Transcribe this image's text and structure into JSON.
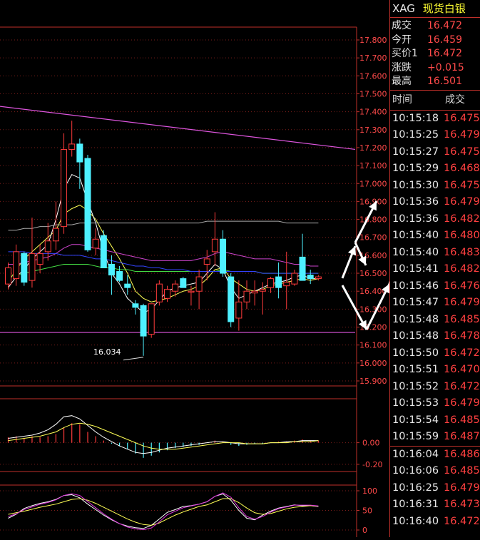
{
  "quote": {
    "symbol": "XAG",
    "name": "现货白银",
    "rows": [
      {
        "label": "成交",
        "value": "16.472"
      },
      {
        "label": "今开",
        "value": "16.459"
      },
      {
        "label": "买价1",
        "value": "16.472"
      },
      {
        "label": "涨跌",
        "value": "+0.015"
      },
      {
        "label": "最高",
        "value": "16.501"
      }
    ]
  },
  "ticks": {
    "header_time": "时间",
    "header_price": "成交",
    "rows": [
      {
        "time": "10:15:18",
        "price": "16.475"
      },
      {
        "time": "10:15:25",
        "price": "16.479"
      },
      {
        "time": "10:15:27",
        "price": "16.475"
      },
      {
        "time": "10:15:29",
        "price": "16.468"
      },
      {
        "time": "10:15:30",
        "price": "16.475"
      },
      {
        "time": "10:15:36",
        "price": "16.479"
      },
      {
        "time": "10:15:36",
        "price": "16.482"
      },
      {
        "time": "10:15:40",
        "price": "16.480"
      },
      {
        "time": "10:15:40",
        "price": "16.483"
      },
      {
        "time": "10:15:41",
        "price": "16.482"
      },
      {
        "time": "10:15:46",
        "price": "16.476"
      },
      {
        "time": "10:15:47",
        "price": "16.479"
      },
      {
        "time": "10:15:48",
        "price": "16.485"
      },
      {
        "time": "10:15:48",
        "price": "16.478"
      },
      {
        "time": "10:15:50",
        "price": "16.472"
      },
      {
        "time": "10:15:51",
        "price": "16.470"
      },
      {
        "time": "10:15:52",
        "price": "16.472"
      },
      {
        "time": "10:15:53",
        "price": "16.479"
      },
      {
        "time": "10:15:54",
        "price": "16.485"
      },
      {
        "time": "10:15:59",
        "price": "16.487"
      },
      {
        "time": "10:16:04",
        "price": "16.486"
      },
      {
        "time": "10:16:06",
        "price": "16.485"
      },
      {
        "time": "10:16:25",
        "price": "16.479"
      },
      {
        "time": "10:16:31",
        "price": "16.473"
      },
      {
        "time": "10:16:40",
        "price": "16.472"
      }
    ]
  },
  "chart_data": [
    {
      "type": "candlestick",
      "y_ticks": [
        "17.800",
        "17.700",
        "17.600",
        "17.500",
        "17.400",
        "17.300",
        "17.200",
        "17.100",
        "17.000",
        "16.900",
        "16.800",
        "16.700",
        "16.600",
        "16.500",
        "16.400",
        "16.300",
        "16.200",
        "16.100",
        "16.000",
        "15.900"
      ],
      "ylim": [
        15.9,
        17.8
      ],
      "low_annotation": "16.034",
      "colors": {
        "up": "#ff3b3b",
        "down": "#4ef0ff",
        "axis": "#c0302a"
      },
      "candles": [
        {
          "o": 16.44,
          "h": 16.56,
          "l": 16.41,
          "c": 16.53
        },
        {
          "o": 16.47,
          "h": 16.66,
          "l": 16.43,
          "c": 16.62
        },
        {
          "o": 16.61,
          "h": 16.62,
          "l": 16.43,
          "c": 16.45
        },
        {
          "o": 16.46,
          "h": 16.81,
          "l": 16.42,
          "c": 16.61
        },
        {
          "o": 16.55,
          "h": 16.66,
          "l": 16.5,
          "c": 16.61
        },
        {
          "o": 16.62,
          "h": 16.78,
          "l": 16.57,
          "c": 16.68
        },
        {
          "o": 16.68,
          "h": 16.9,
          "l": 16.63,
          "c": 16.75
        },
        {
          "o": 16.76,
          "h": 17.28,
          "l": 16.72,
          "c": 17.19
        },
        {
          "o": 17.19,
          "h": 17.35,
          "l": 17.15,
          "c": 17.22
        },
        {
          "o": 17.22,
          "h": 17.25,
          "l": 16.97,
          "c": 17.12
        },
        {
          "o": 17.14,
          "h": 17.16,
          "l": 16.62,
          "c": 16.63
        },
        {
          "o": 16.64,
          "h": 16.75,
          "l": 16.6,
          "c": 16.69
        },
        {
          "o": 16.71,
          "h": 16.74,
          "l": 16.54,
          "c": 16.53
        },
        {
          "o": 16.55,
          "h": 16.6,
          "l": 16.38,
          "c": 16.49
        },
        {
          "o": 16.51,
          "h": 16.54,
          "l": 16.45,
          "c": 16.46
        },
        {
          "o": 16.44,
          "h": 16.49,
          "l": 16.38,
          "c": 16.42
        },
        {
          "o": 16.33,
          "h": 16.35,
          "l": 16.27,
          "c": 16.31
        },
        {
          "o": 16.32,
          "h": 16.33,
          "l": 16.04,
          "c": 16.15
        },
        {
          "o": 16.16,
          "h": 16.3,
          "l": 16.14,
          "c": 16.33
        },
        {
          "o": 16.34,
          "h": 16.46,
          "l": 16.32,
          "c": 16.44
        },
        {
          "o": 16.36,
          "h": 16.43,
          "l": 16.34,
          "c": 16.41
        },
        {
          "o": 16.4,
          "h": 16.46,
          "l": 16.37,
          "c": 16.44
        },
        {
          "o": 16.47,
          "h": 16.48,
          "l": 16.42,
          "c": 16.42
        },
        {
          "o": 16.4,
          "h": 16.43,
          "l": 16.32,
          "c": 16.4
        },
        {
          "o": 16.4,
          "h": 16.52,
          "l": 16.3,
          "c": 16.48
        },
        {
          "o": 16.55,
          "h": 16.63,
          "l": 16.46,
          "c": 16.58
        },
        {
          "o": 16.62,
          "h": 16.84,
          "l": 16.54,
          "c": 16.69
        },
        {
          "o": 16.69,
          "h": 16.74,
          "l": 16.48,
          "c": 16.5
        },
        {
          "o": 16.48,
          "h": 16.5,
          "l": 16.2,
          "c": 16.23
        },
        {
          "o": 16.25,
          "h": 16.46,
          "l": 16.18,
          "c": 16.34
        },
        {
          "o": 16.34,
          "h": 16.46,
          "l": 16.3,
          "c": 16.4
        },
        {
          "o": 16.39,
          "h": 16.46,
          "l": 16.32,
          "c": 16.4
        },
        {
          "o": 16.4,
          "h": 16.45,
          "l": 16.27,
          "c": 16.41
        },
        {
          "o": 16.42,
          "h": 16.48,
          "l": 16.39,
          "c": 16.47
        },
        {
          "o": 16.48,
          "h": 16.56,
          "l": 16.36,
          "c": 16.42
        },
        {
          "o": 16.43,
          "h": 16.62,
          "l": 16.3,
          "c": 16.45
        },
        {
          "o": 16.44,
          "h": 16.52,
          "l": 16.43,
          "c": 16.5
        },
        {
          "o": 16.59,
          "h": 16.72,
          "l": 16.46,
          "c": 16.46
        },
        {
          "o": 16.49,
          "h": 16.52,
          "l": 16.44,
          "c": 16.47
        },
        {
          "o": 16.47,
          "h": 16.49,
          "l": 16.46,
          "c": 16.48
        }
      ],
      "ma_lines": [
        {
          "color": "#ffff55",
          "points": [
            16.45,
            16.52,
            16.58,
            16.62,
            16.66,
            16.7,
            16.74,
            16.83,
            16.86,
            16.88,
            16.85,
            16.8,
            16.72,
            16.65,
            16.58,
            16.5,
            16.4,
            16.36,
            16.34,
            16.35,
            16.36,
            16.38,
            16.4,
            16.41,
            16.43,
            16.47,
            16.52,
            16.53,
            16.47,
            16.44,
            16.41,
            16.4,
            16.41,
            16.43,
            16.44,
            16.45,
            16.46,
            16.47,
            16.46,
            16.47
          ]
        },
        {
          "color": "#ffffff",
          "points": [
            16.42,
            16.48,
            16.52,
            16.58,
            16.62,
            16.66,
            16.8,
            16.97,
            17.05,
            17.03,
            16.9,
            16.78,
            16.62,
            16.5,
            16.44,
            16.36,
            16.32,
            16.28,
            16.3,
            16.35,
            16.4,
            16.42,
            16.43,
            16.44,
            16.45,
            16.5,
            16.55,
            16.52,
            16.42,
            16.36,
            16.38,
            16.4,
            16.42,
            16.44,
            16.45,
            16.46,
            16.48,
            16.49,
            16.47,
            16.47
          ]
        },
        {
          "color": "#cc44cc",
          "points": [
            16.55,
            16.55,
            16.56,
            16.57,
            16.58,
            16.59,
            16.61,
            16.64,
            16.66,
            16.66,
            16.65,
            16.64,
            16.63,
            16.62,
            16.61,
            16.6,
            16.59,
            16.58,
            16.57,
            16.57,
            16.57,
            16.57,
            16.57,
            16.57,
            16.58,
            16.59,
            16.61,
            16.62,
            16.61,
            16.6,
            16.59,
            16.58,
            16.58,
            16.58,
            16.57,
            16.56,
            16.55,
            16.55,
            16.54,
            16.54
          ]
        },
        {
          "color": "#44dd44",
          "points": [
            16.48,
            16.49,
            16.5,
            16.51,
            16.52,
            16.53,
            16.54,
            16.55,
            16.55,
            16.55,
            16.55,
            16.54,
            16.53,
            16.53,
            16.52,
            16.52,
            16.51,
            16.51,
            16.51,
            16.51,
            16.51,
            16.51,
            16.51,
            16.51,
            16.51,
            16.51,
            16.51,
            16.52,
            16.51,
            16.51,
            16.51,
            16.51,
            16.5,
            16.5,
            16.5,
            16.5,
            16.5,
            16.5,
            16.5,
            16.5
          ]
        },
        {
          "color": "#3344ff",
          "points": [
            16.62,
            16.62,
            16.62,
            16.61,
            16.61,
            16.61,
            16.61,
            16.6,
            16.6,
            16.6,
            16.59,
            16.58,
            16.58,
            16.57,
            16.56,
            16.55,
            16.54,
            16.54,
            16.53,
            16.53,
            16.52,
            16.52,
            16.52,
            16.51,
            16.51,
            16.51,
            16.51,
            16.51,
            16.51,
            16.51,
            16.51,
            16.51,
            16.5,
            16.5,
            16.5,
            16.5,
            16.5,
            16.5,
            16.5,
            16.5
          ]
        },
        {
          "color": "#aaaaaa",
          "points": [
            16.74,
            16.74,
            16.75,
            16.75,
            16.76,
            16.76,
            16.77,
            16.77,
            16.77,
            16.78,
            16.78,
            16.78,
            16.78,
            16.78,
            16.78,
            16.78,
            16.78,
            16.78,
            16.78,
            16.78,
            16.78,
            16.78,
            16.78,
            16.78,
            16.78,
            16.79,
            16.79,
            16.79,
            16.79,
            16.79,
            16.79,
            16.79,
            16.79,
            16.79,
            16.79,
            16.78,
            16.78,
            16.78,
            16.78,
            16.78
          ]
        }
      ],
      "trend_line": {
        "color": "#dd55dd",
        "from": 17.43,
        "to": 17.19
      },
      "support_line": {
        "color": "#dd55dd",
        "value": 16.17
      }
    },
    {
      "type": "bar",
      "y_ticks": [
        "0.00",
        "-0.20"
      ],
      "ylim": [
        -0.26,
        0.4
      ],
      "macd_bars": [
        0.05,
        0.06,
        0.04,
        0.06,
        0.05,
        0.06,
        0.08,
        0.14,
        0.18,
        0.17,
        0.1,
        0.06,
        0.02,
        -0.01,
        -0.03,
        -0.06,
        -0.1,
        -0.14,
        -0.12,
        -0.09,
        -0.07,
        -0.05,
        -0.04,
        -0.03,
        -0.02,
        0.0,
        0.02,
        0.01,
        -0.02,
        -0.03,
        -0.02,
        -0.01,
        -0.01,
        0.0,
        0.01,
        0.01,
        0.02,
        0.03,
        0.02,
        0.02
      ],
      "dif": [
        0.04,
        0.05,
        0.06,
        0.07,
        0.09,
        0.12,
        0.17,
        0.24,
        0.25,
        0.22,
        0.16,
        0.1,
        0.05,
        0.01,
        -0.03,
        -0.06,
        -0.09,
        -0.1,
        -0.09,
        -0.07,
        -0.05,
        -0.04,
        -0.03,
        -0.02,
        -0.01,
        0.0,
        0.01,
        0.01,
        0.0,
        -0.01,
        -0.01,
        -0.01,
        -0.01,
        0.0,
        0.0,
        0.01,
        0.01,
        0.02,
        0.02,
        0.02
      ],
      "dea": [
        0.02,
        0.03,
        0.04,
        0.05,
        0.06,
        0.08,
        0.1,
        0.14,
        0.17,
        0.18,
        0.17,
        0.15,
        0.12,
        0.09,
        0.06,
        0.03,
        0.0,
        -0.03,
        -0.05,
        -0.06,
        -0.06,
        -0.06,
        -0.05,
        -0.04,
        -0.03,
        -0.02,
        -0.01,
        0.0,
        0.0,
        0.0,
        -0.01,
        -0.01,
        -0.01,
        0.0,
        0.0,
        0.0,
        0.01,
        0.01,
        0.01,
        0.02
      ]
    },
    {
      "type": "line",
      "y_ticks": [
        "100",
        "50",
        "0"
      ],
      "ylim": [
        0,
        100
      ],
      "k": [
        30,
        40,
        55,
        62,
        68,
        72,
        78,
        88,
        90,
        82,
        66,
        52,
        38,
        26,
        16,
        10,
        6,
        4,
        12,
        28,
        45,
        52,
        60,
        62,
        66,
        72,
        86,
        92,
        76,
        50,
        30,
        26,
        38,
        48,
        56,
        60,
        64,
        62,
        62,
        60
      ],
      "d": [
        40,
        44,
        48,
        53,
        58,
        62,
        66,
        72,
        78,
        80,
        76,
        68,
        58,
        48,
        38,
        28,
        20,
        14,
        12,
        18,
        28,
        38,
        46,
        53,
        60,
        64,
        72,
        80,
        80,
        70,
        56,
        44,
        40,
        42,
        48,
        54,
        58,
        60,
        62,
        61
      ],
      "j": [
        36,
        42,
        52,
        58,
        64,
        68,
        74,
        84,
        88,
        84,
        70,
        56,
        42,
        30,
        20,
        12,
        8,
        6,
        10,
        24,
        40,
        48,
        56,
        60,
        64,
        70,
        82,
        90,
        80,
        56,
        36,
        30,
        36,
        46,
        54,
        58,
        62,
        62,
        62,
        60
      ]
    }
  ]
}
